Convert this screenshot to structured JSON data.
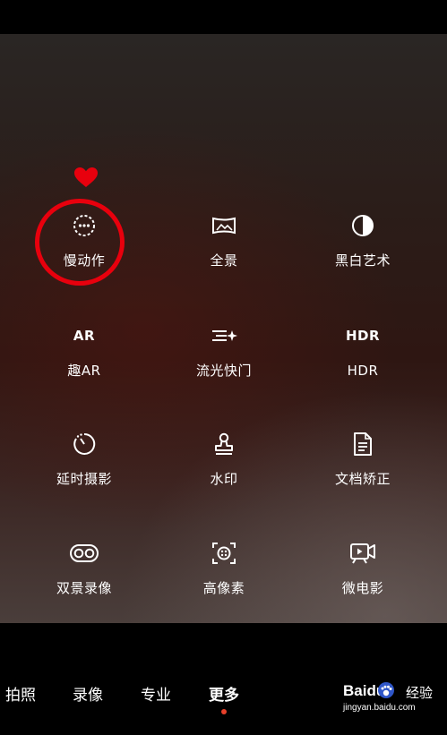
{
  "modes": [
    {
      "label": "慢动作",
      "icon": "slow-motion-icon"
    },
    {
      "label": "全景",
      "icon": "panorama-icon"
    },
    {
      "label": "黑白艺术",
      "icon": "monochrome-icon"
    },
    {
      "label": "趣AR",
      "icon": "ar-icon",
      "icon_text": "AR"
    },
    {
      "label": "流光快门",
      "icon": "light-painting-icon"
    },
    {
      "label": "HDR",
      "icon": "hdr-icon",
      "icon_text": "HDR"
    },
    {
      "label": "延时摄影",
      "icon": "time-lapse-icon"
    },
    {
      "label": "水印",
      "icon": "watermark-stamp-icon"
    },
    {
      "label": "文档矫正",
      "icon": "document-icon"
    },
    {
      "label": "双景录像",
      "icon": "dual-view-icon"
    },
    {
      "label": "高像素",
      "icon": "high-res-icon"
    },
    {
      "label": "微电影",
      "icon": "micro-movie-icon"
    }
  ],
  "tabs": [
    {
      "label": "拍照"
    },
    {
      "label": "录像"
    },
    {
      "label": "专业"
    },
    {
      "label": "更多",
      "active": true
    }
  ],
  "annotation": {
    "color": "#e8000d"
  },
  "watermark": {
    "brand": "Baidu",
    "cn": "经验",
    "url": "jingyan.baidu.com"
  }
}
